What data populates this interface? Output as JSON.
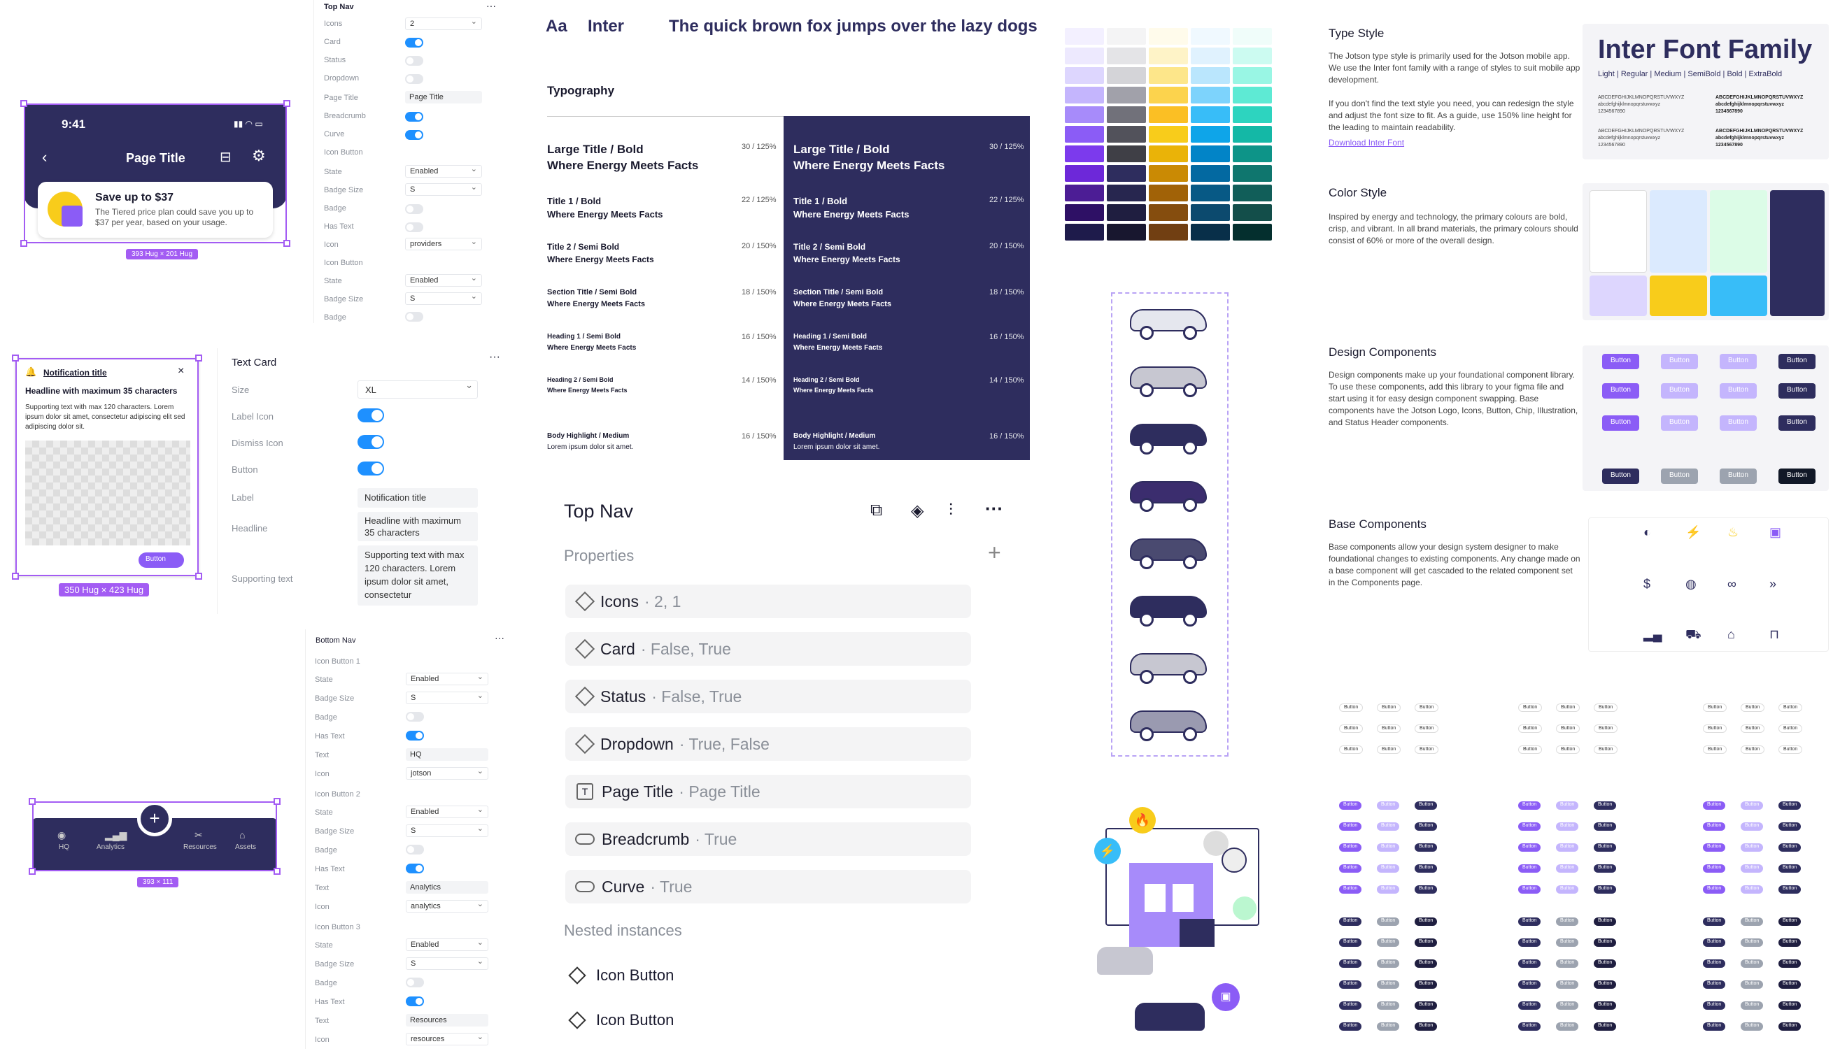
{
  "mobile_header": {
    "time": "9:41",
    "title": "Page Title",
    "banner_title": "Save up to $37",
    "banner_text": "The Tiered price plan could save you up to $37 per year, based on your usage.",
    "size_tag": "393 Hug × 201 Hug"
  },
  "topnav_panel": {
    "title": "Top Nav",
    "rows": [
      {
        "label": "Icons",
        "value": "2"
      },
      {
        "label": "Card"
      },
      {
        "label": "Status"
      },
      {
        "label": "Dropdown"
      },
      {
        "label": "Page Title",
        "value": "Page Title"
      },
      {
        "label": "Breadcrumb"
      },
      {
        "label": "Curve"
      },
      {
        "label": "Icon Button"
      },
      {
        "label": "State",
        "value": "Enabled"
      },
      {
        "label": "Badge Size",
        "value": "S"
      },
      {
        "label": "Badge"
      },
      {
        "label": "Has Text"
      },
      {
        "label": "Icon",
        "value": "providers"
      },
      {
        "label": "Icon Button"
      },
      {
        "label": "State",
        "value": "Enabled"
      },
      {
        "label": "Badge Size",
        "value": "S"
      },
      {
        "label": "Badge"
      }
    ]
  },
  "notification": {
    "title": "Notification title",
    "headline": "Headline with maximum 35 characters",
    "body": "Supporting text with max 120 characters. Lorem ipsum dolor sit amet, consectetur adipiscing elit sed adipiscing dolor sit.",
    "button": "Button",
    "size_tag": "350 Hug × 423 Hug"
  },
  "textcard_panel": {
    "title": "Text Card",
    "size_label": "Size",
    "size_value": "XL",
    "label_icon": "Label Icon",
    "dismiss_icon": "Dismiss Icon",
    "button": "Button",
    "label": "Label",
    "label_value": "Notification title",
    "headline": "Headline",
    "headline_value": "Headline with maximum 35 characters",
    "supporting": "Supporting text",
    "supporting_value": "Supporting text with max 120 characters. Lorem ipsum dolor sit amet, consectetur"
  },
  "bottom_nav": {
    "items": [
      "HQ",
      "Analytics",
      "Resources",
      "Assets"
    ],
    "size_tag": "393 × 111"
  },
  "bottomnav_panel": {
    "title": "Bottom Nav",
    "groups": [
      {
        "name": "Icon Button 1",
        "text": "HQ",
        "icon": "jotson"
      },
      {
        "name": "Icon Button 2",
        "text": "Analytics",
        "icon": "analytics"
      },
      {
        "name": "Icon Button 3",
        "text": "Resources",
        "icon": "resources"
      }
    ],
    "labels": {
      "state": "State",
      "badge_size": "Badge Size",
      "badge": "Badge",
      "has_text": "Has Text",
      "text": "Text",
      "icon": "Icon"
    },
    "state_value": "Enabled",
    "badge_value": "S"
  },
  "typography": {
    "aa": "Aa",
    "font": "Inter",
    "pangram": "The quick brown fox jumps over the lazy dogs",
    "heading": "Typography",
    "rows": [
      {
        "name": "Large Title / Bold",
        "sample": "Where Energy Meets Facts",
        "meta": "30 / 125%"
      },
      {
        "name": "Title 1 / Bold",
        "sample": "Where Energy Meets Facts",
        "meta": "22 / 125%"
      },
      {
        "name": "Title 2 / Semi Bold",
        "sample": "Where Energy Meets Facts",
        "meta": "20 / 150%"
      },
      {
        "name": "Section Title / Semi Bold",
        "sample": "Where Energy Meets Facts",
        "meta": "18 / 150%"
      },
      {
        "name": "Heading 1 / Semi Bold",
        "sample": "Where Energy Meets Facts",
        "meta": "16 / 150%"
      },
      {
        "name": "Heading 2 / Semi Bold",
        "sample": "Where Energy Meets Facts",
        "meta": "14 / 150%"
      },
      {
        "name": "Body Highlight / Medium",
        "sample": "Lorem ipsum dolor sit amet.",
        "meta": "16 / 150%"
      }
    ]
  },
  "properties": {
    "title": "Top Nav",
    "section": "Properties",
    "rows": [
      {
        "name": "Icons",
        "value": "· 2, 1"
      },
      {
        "name": "Card",
        "value": "· False, True"
      },
      {
        "name": "Status",
        "value": "· False, True"
      },
      {
        "name": "Dropdown",
        "value": "· True, False"
      },
      {
        "name": "Page Title",
        "value": "· Page Title"
      },
      {
        "name": "Breadcrumb",
        "value": "· True"
      },
      {
        "name": "Curve",
        "value": "· True"
      }
    ],
    "nested": "Nested instances",
    "nested_items": [
      "Icon Button",
      "Icon Button"
    ]
  },
  "doc": {
    "type_style": {
      "title": "Type Style",
      "body": "The Jotson type style is primarily used for the Jotson mobile app. We use the Inter font family with a range of styles to suit mobile app development.",
      "body2": "If you don't find the text style you need, you can redesign the style and adjust the font size to fit. As a guide, use 150% line height for the leading to maintain readability.",
      "link": "Download Inter Font"
    },
    "inter_card": {
      "title": "Inter Font Family",
      "weights": "Light | Regular | Medium | SemiBold | Bold | ExtraBold",
      "upper": "ABCDEFGHIJKLMNOPQRSTUVWXYZ",
      "lower": "abcdefghijklmnopqrstuvwxyz",
      "digits": "1234567890"
    },
    "color_style": {
      "title": "Color Style",
      "body": "Inspired by energy and technology, the primary colours are bold, crisp, and vibrant. In all brand materials, the primary colours should consist of 60% or more of the overall design."
    },
    "design_components": {
      "title": "Design Components",
      "body": "Design components make up your foundational component library. To use these components, add this library to your figma file and start using it for easy design component swapping. Base components have the Jotson Logo, Icons, Button, Chip, Illustration, and Status Header components.",
      "button": "Button"
    },
    "base_components": {
      "title": "Base Components",
      "body": "Base components allow your design system designer to make foundational changes to existing components. Any change made on a base component will get cascaded to the related component set in the Components page."
    }
  },
  "colors": {
    "navy": "#2e2d5e",
    "purple": "#8b5cf6",
    "selection": "#a35cf3",
    "blue_toggle": "#1e90ff",
    "yellow": "#f8cc1b",
    "cyan": "#38bdf8"
  }
}
